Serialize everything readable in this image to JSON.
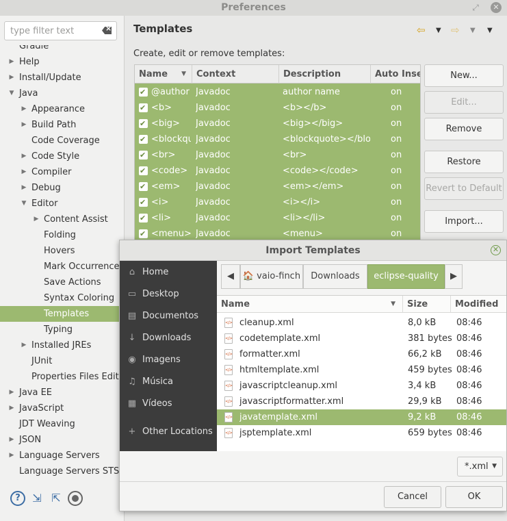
{
  "window": {
    "title": "Preferences"
  },
  "sidebar": {
    "filter_placeholder": "type filter text",
    "items": [
      {
        "label": "Gradle",
        "level": 1,
        "arrow": ""
      },
      {
        "label": "Help",
        "level": 1,
        "arrow": "right"
      },
      {
        "label": "Install/Update",
        "level": 1,
        "arrow": "right"
      },
      {
        "label": "Java",
        "level": 1,
        "arrow": "down"
      },
      {
        "label": "Appearance",
        "level": 2,
        "arrow": "right"
      },
      {
        "label": "Build Path",
        "level": 2,
        "arrow": "right"
      },
      {
        "label": "Code Coverage",
        "level": 2,
        "arrow": ""
      },
      {
        "label": "Code Style",
        "level": 2,
        "arrow": "right"
      },
      {
        "label": "Compiler",
        "level": 2,
        "arrow": "right"
      },
      {
        "label": "Debug",
        "level": 2,
        "arrow": "right"
      },
      {
        "label": "Editor",
        "level": 2,
        "arrow": "down"
      },
      {
        "label": "Content Assist",
        "level": 3,
        "arrow": "right"
      },
      {
        "label": "Folding",
        "level": 3,
        "arrow": ""
      },
      {
        "label": "Hovers",
        "level": 3,
        "arrow": ""
      },
      {
        "label": "Mark Occurrences",
        "level": 3,
        "arrow": ""
      },
      {
        "label": "Save Actions",
        "level": 3,
        "arrow": ""
      },
      {
        "label": "Syntax Coloring",
        "level": 3,
        "arrow": ""
      },
      {
        "label": "Templates",
        "level": 3,
        "arrow": "",
        "selected": true
      },
      {
        "label": "Typing",
        "level": 3,
        "arrow": ""
      },
      {
        "label": "Installed JREs",
        "level": 2,
        "arrow": "right"
      },
      {
        "label": "JUnit",
        "level": 2,
        "arrow": ""
      },
      {
        "label": "Properties Files Editor",
        "level": 2,
        "arrow": ""
      },
      {
        "label": "Java EE",
        "level": 1,
        "arrow": "right"
      },
      {
        "label": "JavaScript",
        "level": 1,
        "arrow": "right"
      },
      {
        "label": "JDT Weaving",
        "level": 1,
        "arrow": ""
      },
      {
        "label": "JSON",
        "level": 1,
        "arrow": "right"
      },
      {
        "label": "Language Servers",
        "level": 1,
        "arrow": "right"
      },
      {
        "label": "Language Servers STS",
        "level": 1,
        "arrow": ""
      }
    ],
    "bottom_icons": [
      "help-icon",
      "import-icon",
      "export-icon",
      "record-icon"
    ]
  },
  "templates": {
    "title": "Templates",
    "description": "Create, edit or remove templates:",
    "columns": [
      "Name",
      "Context",
      "Description",
      "Auto Insert"
    ],
    "rows": [
      {
        "name": "@author",
        "context": "Javadoc",
        "description": "author name",
        "auto": "on"
      },
      {
        "name": "<b>",
        "context": "Javadoc",
        "description": "<b></b>",
        "auto": "on"
      },
      {
        "name": "<big>",
        "context": "Javadoc",
        "description": "<big></big>",
        "auto": "on"
      },
      {
        "name": "<blockquote>",
        "context": "Javadoc",
        "description": "<blockquote></blockquote>",
        "auto": "on"
      },
      {
        "name": "<br>",
        "context": "Javadoc",
        "description": "<br>",
        "auto": "on"
      },
      {
        "name": "<code>",
        "context": "Javadoc",
        "description": "<code></code>",
        "auto": "on"
      },
      {
        "name": "<em>",
        "context": "Javadoc",
        "description": "<em></em>",
        "auto": "on"
      },
      {
        "name": "<i>",
        "context": "Javadoc",
        "description": "<i></i>",
        "auto": "on"
      },
      {
        "name": "<li>",
        "context": "Javadoc",
        "description": "<li></li>",
        "auto": "on"
      },
      {
        "name": "<menu>",
        "context": "Javadoc",
        "description": "<menu>",
        "auto": "on"
      }
    ],
    "buttons": {
      "new": "New...",
      "edit": "Edit...",
      "remove": "Remove",
      "restore_removed": "Restore Removed",
      "revert_default": "Revert to Default",
      "import": "Import..."
    }
  },
  "dialog": {
    "title": "Import Templates",
    "places": [
      {
        "label": "Home",
        "icon": "home-icon"
      },
      {
        "label": "Desktop",
        "icon": "desktop-icon"
      },
      {
        "label": "Documentos",
        "icon": "document-icon"
      },
      {
        "label": "Downloads",
        "icon": "download-icon"
      },
      {
        "label": "Imagens",
        "icon": "camera-icon"
      },
      {
        "label": "Música",
        "icon": "music-icon"
      },
      {
        "label": "Vídeos",
        "icon": "film-icon"
      },
      {
        "label": "Other Locations",
        "icon": "plus-icon"
      }
    ],
    "path": [
      "vaio-finch",
      "Downloads",
      "eclipse-quality"
    ],
    "columns": [
      "Name",
      "Size",
      "Modified"
    ],
    "files": [
      {
        "name": "cleanup.xml",
        "size": "8,0 kB",
        "modified": "08:46"
      },
      {
        "name": "codetemplate.xml",
        "size": "381 bytes",
        "modified": "08:46"
      },
      {
        "name": "formatter.xml",
        "size": "66,2 kB",
        "modified": "08:46"
      },
      {
        "name": "htmltemplate.xml",
        "size": "459 bytes",
        "modified": "08:46"
      },
      {
        "name": "javascriptcleanup.xml",
        "size": "3,4 kB",
        "modified": "08:46"
      },
      {
        "name": "javascriptformatter.xml",
        "size": "29,9 kB",
        "modified": "08:46"
      },
      {
        "name": "javatemplate.xml",
        "size": "9,2 kB",
        "modified": "08:46",
        "selected": true
      },
      {
        "name": "jsptemplate.xml",
        "size": "659 bytes",
        "modified": "08:46"
      }
    ],
    "filter": "*.xml",
    "cancel": "Cancel",
    "ok": "OK"
  }
}
